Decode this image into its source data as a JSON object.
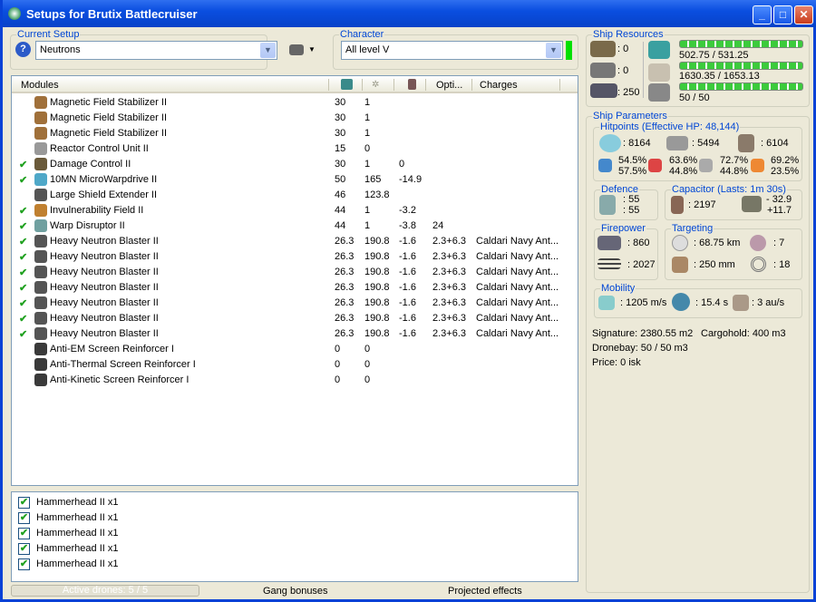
{
  "window": {
    "title": "Setups for Brutix Battlecruiser",
    "minimize": "_",
    "maximize": "□",
    "close": "✕"
  },
  "setup": {
    "label": "Current Setup",
    "value": "Neutrons",
    "help_icon": "?"
  },
  "character": {
    "label": "Character",
    "value": "All level V",
    "status_color": "#00e000"
  },
  "modules": {
    "headers": [
      "Modules",
      "",
      "",
      "",
      "Opti...",
      "Charges"
    ],
    "rows": [
      {
        "checked": false,
        "name": "Magnetic Field Stabilizer II",
        "cpu": "30",
        "pg": "1",
        "cap": "",
        "opt": "",
        "charges": "",
        "color": "#a0703a"
      },
      {
        "checked": false,
        "name": "Magnetic Field Stabilizer II",
        "cpu": "30",
        "pg": "1",
        "cap": "",
        "opt": "",
        "charges": "",
        "color": "#a0703a"
      },
      {
        "checked": false,
        "name": "Magnetic Field Stabilizer II",
        "cpu": "30",
        "pg": "1",
        "cap": "",
        "opt": "",
        "charges": "",
        "color": "#a0703a"
      },
      {
        "checked": false,
        "name": "Reactor Control Unit II",
        "cpu": "15",
        "pg": "0",
        "cap": "",
        "opt": "",
        "charges": "",
        "color": "#999"
      },
      {
        "checked": true,
        "name": "Damage Control II",
        "cpu": "30",
        "pg": "1",
        "cap": "0",
        "opt": "",
        "charges": "",
        "color": "#6a5a3a"
      },
      {
        "checked": true,
        "name": "10MN MicroWarpdrive II",
        "cpu": "50",
        "pg": "165",
        "cap": "-14.9",
        "opt": "",
        "charges": "",
        "color": "#4fa8c8"
      },
      {
        "checked": false,
        "name": "Large Shield Extender II",
        "cpu": "46",
        "pg": "123.8",
        "cap": "",
        "opt": "",
        "charges": "",
        "color": "#555"
      },
      {
        "checked": true,
        "name": "Invulnerability Field II",
        "cpu": "44",
        "pg": "1",
        "cap": "-3.2",
        "opt": "",
        "charges": "",
        "color": "#c08030"
      },
      {
        "checked": true,
        "name": "Warp Disruptor II",
        "cpu": "44",
        "pg": "1",
        "cap": "-3.8",
        "opt": "24",
        "charges": "",
        "color": "#70a0a0"
      },
      {
        "checked": true,
        "name": "Heavy Neutron Blaster II",
        "cpu": "26.3",
        "pg": "190.8",
        "cap": "-1.6",
        "opt": "2.3+6.3",
        "charges": "Caldari Navy Ant...",
        "color": "#555"
      },
      {
        "checked": true,
        "name": "Heavy Neutron Blaster II",
        "cpu": "26.3",
        "pg": "190.8",
        "cap": "-1.6",
        "opt": "2.3+6.3",
        "charges": "Caldari Navy Ant...",
        "color": "#555"
      },
      {
        "checked": true,
        "name": "Heavy Neutron Blaster II",
        "cpu": "26.3",
        "pg": "190.8",
        "cap": "-1.6",
        "opt": "2.3+6.3",
        "charges": "Caldari Navy Ant...",
        "color": "#555"
      },
      {
        "checked": true,
        "name": "Heavy Neutron Blaster II",
        "cpu": "26.3",
        "pg": "190.8",
        "cap": "-1.6",
        "opt": "2.3+6.3",
        "charges": "Caldari Navy Ant...",
        "color": "#555"
      },
      {
        "checked": true,
        "name": "Heavy Neutron Blaster II",
        "cpu": "26.3",
        "pg": "190.8",
        "cap": "-1.6",
        "opt": "2.3+6.3",
        "charges": "Caldari Navy Ant...",
        "color": "#555"
      },
      {
        "checked": true,
        "name": "Heavy Neutron Blaster II",
        "cpu": "26.3",
        "pg": "190.8",
        "cap": "-1.6",
        "opt": "2.3+6.3",
        "charges": "Caldari Navy Ant...",
        "color": "#555"
      },
      {
        "checked": true,
        "name": "Heavy Neutron Blaster II",
        "cpu": "26.3",
        "pg": "190.8",
        "cap": "-1.6",
        "opt": "2.3+6.3",
        "charges": "Caldari Navy Ant...",
        "color": "#555"
      },
      {
        "checked": false,
        "name": "Anti-EM Screen Reinforcer I",
        "cpu": "0",
        "pg": "0",
        "cap": "",
        "opt": "",
        "charges": "",
        "color": "#3a3a3a"
      },
      {
        "checked": false,
        "name": "Anti-Thermal Screen Reinforcer I",
        "cpu": "0",
        "pg": "0",
        "cap": "",
        "opt": "",
        "charges": "",
        "color": "#3a3a3a"
      },
      {
        "checked": false,
        "name": "Anti-Kinetic Screen Reinforcer I",
        "cpu": "0",
        "pg": "0",
        "cap": "",
        "opt": "",
        "charges": "",
        "color": "#3a3a3a"
      }
    ]
  },
  "drones": [
    "Hammerhead II x1",
    "Hammerhead II x1",
    "Hammerhead II x1",
    "Hammerhead II x1",
    "Hammerhead II x1"
  ],
  "bottom": {
    "active_drones": "Active drones: 5 / 5",
    "gang": "Gang bonuses",
    "projected": "Projected effects"
  },
  "resources": {
    "label": "Ship Resources",
    "turrets": ": 0",
    "launchers": ": 0",
    "calibration": ": 250",
    "cpu": "502.75 / 531.25",
    "cpu_fraction": 0.946,
    "pg": "1630.35 / 1653.13",
    "pg_fraction": 0.986,
    "drone_bw": "50 / 50",
    "drone_fraction": 1.0
  },
  "params": {
    "label": "Ship Parameters",
    "hp_label": "Hitpoints (Effective HP: 48,144)",
    "shield": ": 8164",
    "armor": ": 5494",
    "structure": ": 6104",
    "resists": [
      [
        "54.5%",
        "57.5%"
      ],
      [
        "63.6%",
        "44.8%"
      ],
      [
        "72.7%",
        "44.8%"
      ],
      [
        "69.2%",
        "23.5%"
      ]
    ],
    "defence_label": "Defence",
    "def1": ": 55",
    "def2": ": 55",
    "cap_label": "Capacitor (Lasts: 1m 30s)",
    "cap_amount": ": 2197",
    "cap_use": "- 32.9",
    "cap_recharge": "+11.7",
    "fire_label": "Firepower",
    "dps": ": 860",
    "volley": ": 2027",
    "target_label": "Targeting",
    "range": ": 68.75 km",
    "max_targets": ": 7",
    "scan_res": ": 250 mm",
    "sensor": ": 18",
    "mob_label": "Mobility",
    "speed": ": 1205 m/s",
    "align": ": 15.4 s",
    "warp": ": 3 au/s",
    "signature": "Signature: 2380.55 m2",
    "cargo": "Cargohold: 400 m3",
    "dronebay": "Dronebay: 50 / 50 m3",
    "price": "Price: 0 isk"
  }
}
